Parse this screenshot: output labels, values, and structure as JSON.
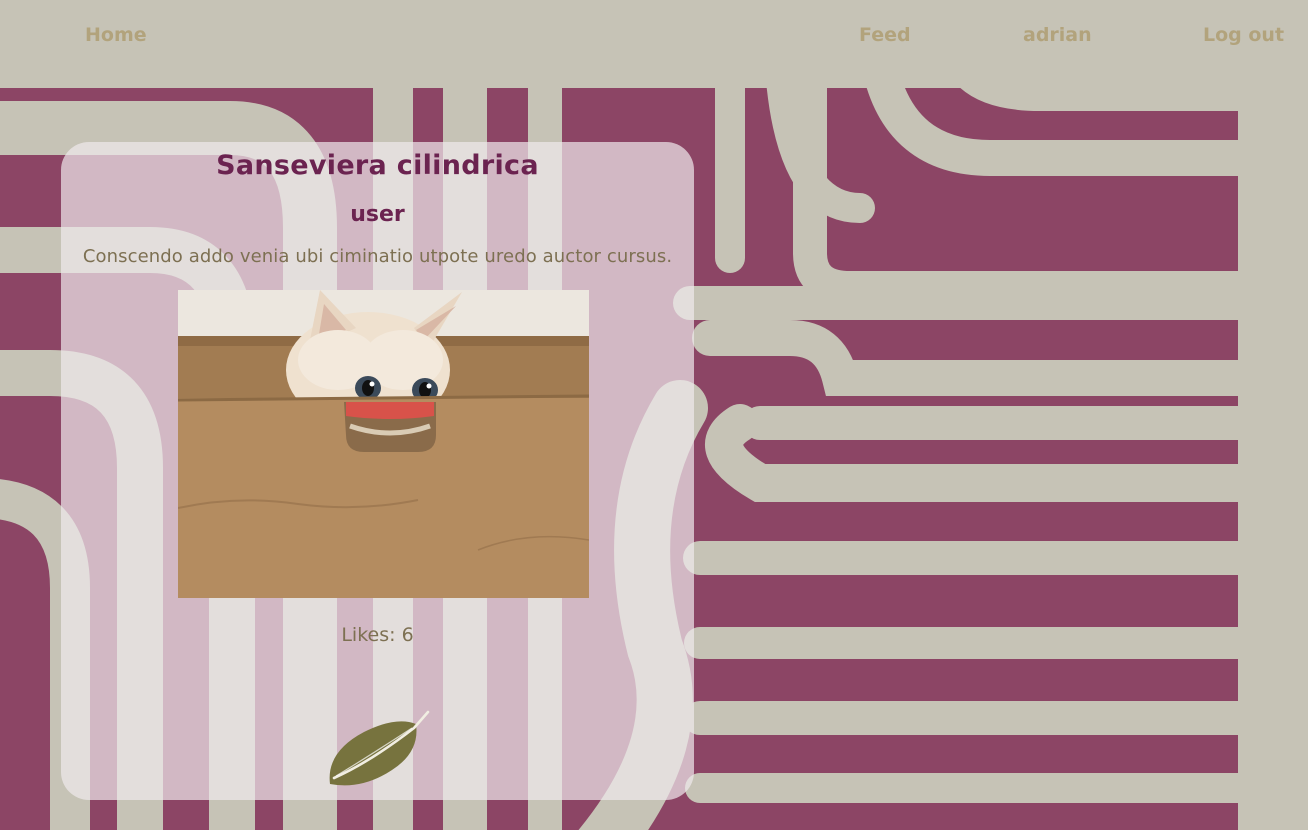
{
  "nav": {
    "home": "Home",
    "feed": "Feed",
    "username": "adrian",
    "logout": "Log out"
  },
  "post": {
    "title": "Sanseviera cilindrica",
    "author": "user",
    "body": "Conscendo addo venia ubi ciminatio utpote uredo auctor cursus.",
    "likes_label": "Likes: 6",
    "image_alt": "cat peeking out of a cardboard box"
  },
  "icons": {
    "like": "leaf-icon"
  },
  "colors": {
    "background": "#c6c3b6",
    "accent": "#8c4565",
    "title": "#6b2350",
    "nav_text": "#b2a37c",
    "body_text": "#7d7052",
    "leaf": "#77733e"
  }
}
